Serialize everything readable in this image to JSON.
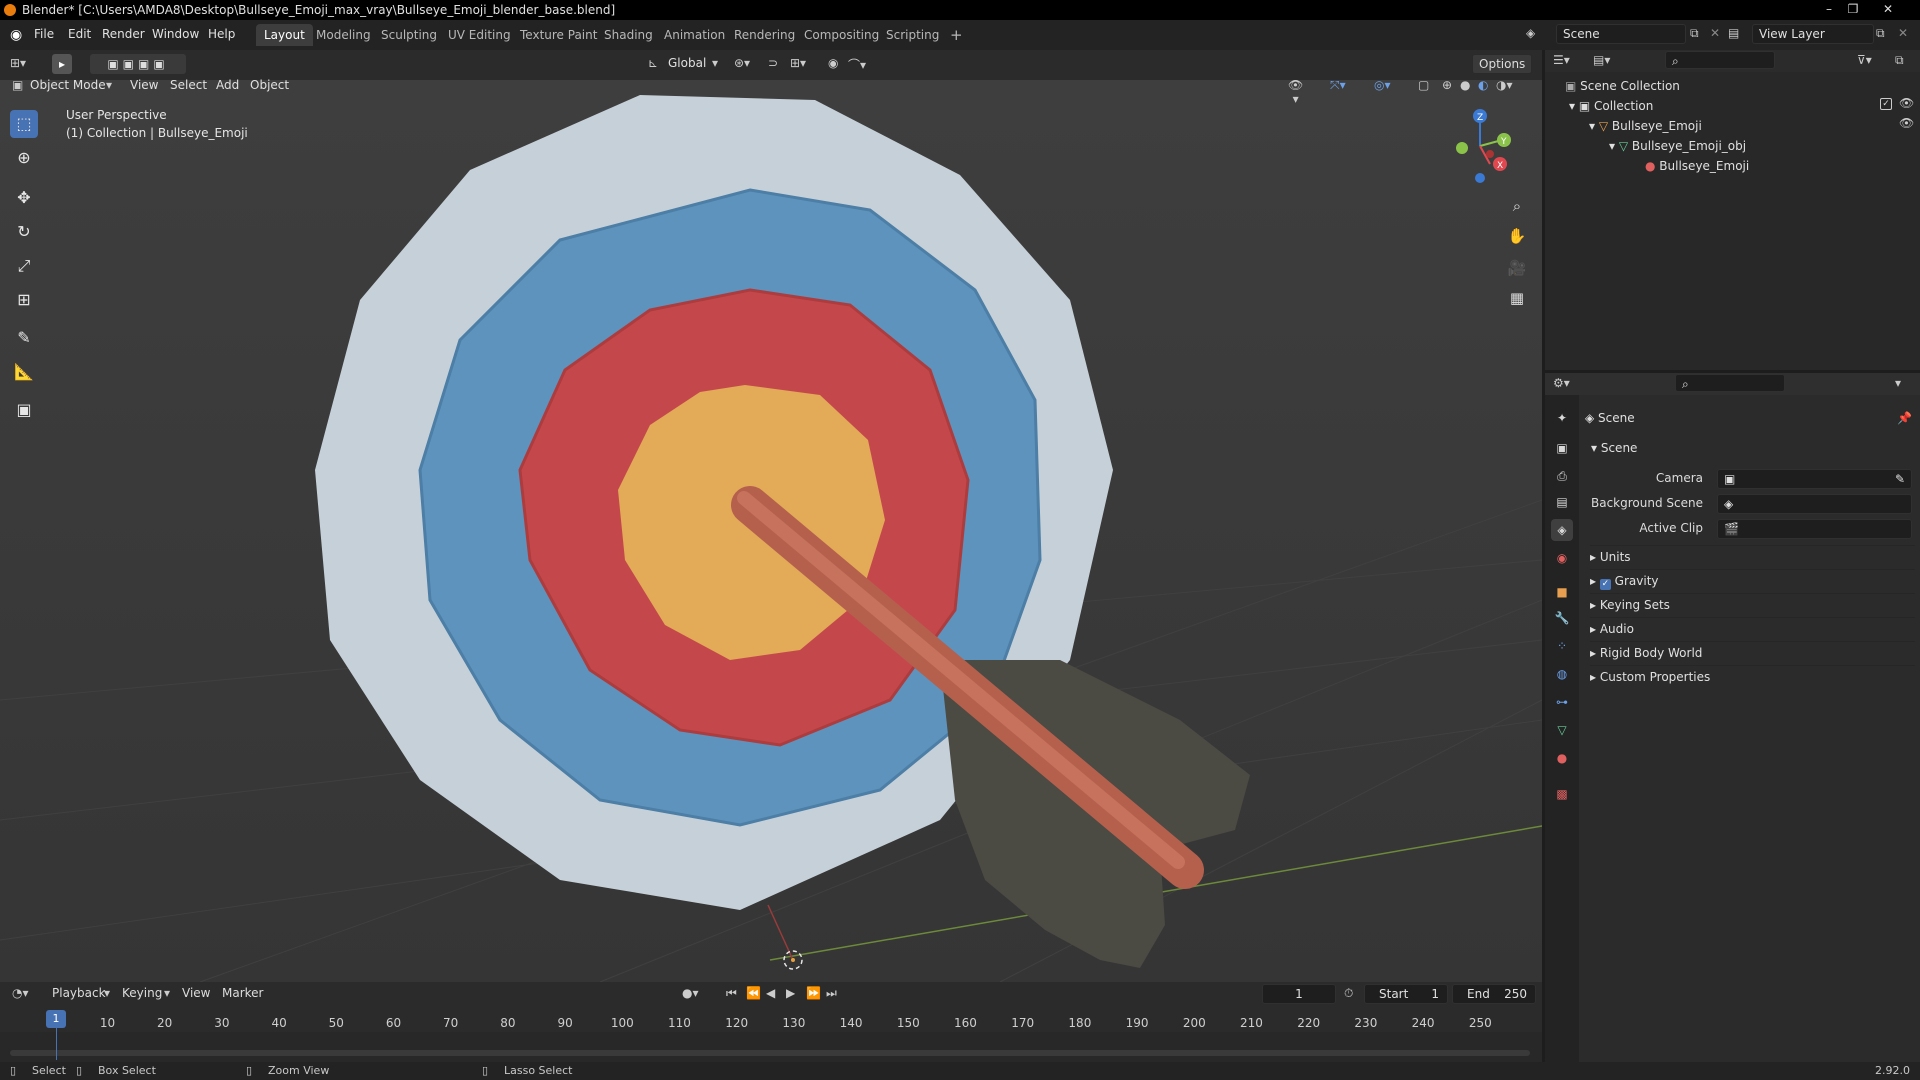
{
  "window": {
    "title": "Blender* [C:\\Users\\AMDA8\\Desktop\\Bullseye_Emoji_max_vray\\Bullseye_Emoji_blender_base.blend]",
    "min": "–",
    "max": "❐",
    "close": "✕"
  },
  "menus": [
    "File",
    "Edit",
    "Render",
    "Window",
    "Help"
  ],
  "workspaces": [
    "Layout",
    "Modeling",
    "Sculpting",
    "UV Editing",
    "Texture Paint",
    "Shading",
    "Animation",
    "Rendering",
    "Compositing",
    "Scripting"
  ],
  "workspace_add": "+",
  "scene_field": "Scene",
  "viewlayer_field": "View Layer",
  "viewport_header": {
    "transform": "Global",
    "options": "Options",
    "mode": "Object Mode",
    "menu_view": "View",
    "menu_select": "Select",
    "menu_add": "Add",
    "menu_object": "Object"
  },
  "viewport": {
    "perspective": "User Perspective",
    "collection": "(1) Collection | Bullseye_Emoji",
    "gizmo": {
      "x": "X",
      "y": "Y",
      "z": "Z"
    }
  },
  "outliner": {
    "root": "Scene Collection",
    "items": [
      {
        "label": "Collection",
        "indent": 1
      },
      {
        "label": "Bullseye_Emoji",
        "indent": 2
      },
      {
        "label": "Bullseye_Emoji_obj",
        "indent": 3
      },
      {
        "label": "Bullseye_Emoji",
        "indent": 4
      }
    ]
  },
  "properties": {
    "context": "Scene",
    "section": "Scene",
    "fields": {
      "camera": "Camera",
      "background_scene": "Background Scene",
      "active_clip": "Active Clip"
    },
    "panels": [
      "Units",
      "Gravity",
      "Keying Sets",
      "Audio",
      "Rigid Body World",
      "Custom Properties"
    ]
  },
  "timeline": {
    "menus": [
      "Playback",
      "Keying",
      "View",
      "Marker"
    ],
    "current_frame": "1",
    "start_label": "Start",
    "start": "1",
    "end_label": "End",
    "end": "250",
    "ticks": [
      "10",
      "20",
      "30",
      "40",
      "50",
      "60",
      "70",
      "80",
      "90",
      "100",
      "110",
      "120",
      "130",
      "140",
      "150",
      "160",
      "170",
      "180",
      "190",
      "200",
      "210",
      "220",
      "230",
      "240",
      "250"
    ],
    "playhead": "1"
  },
  "status": {
    "select": "Select",
    "box_select": "Box Select",
    "zoom_view": "Zoom View",
    "lasso_select": "Lasso Select",
    "version": "2.92.0"
  },
  "colors": {
    "accent": "#4772b3",
    "target_outer": "#c6d0d8",
    "target_blue": "#5d93bd",
    "target_red": "#c4484b",
    "target_center": "#e3aa58",
    "arrow_shaft": "#c06a55",
    "fletching": "#4b4a43"
  }
}
